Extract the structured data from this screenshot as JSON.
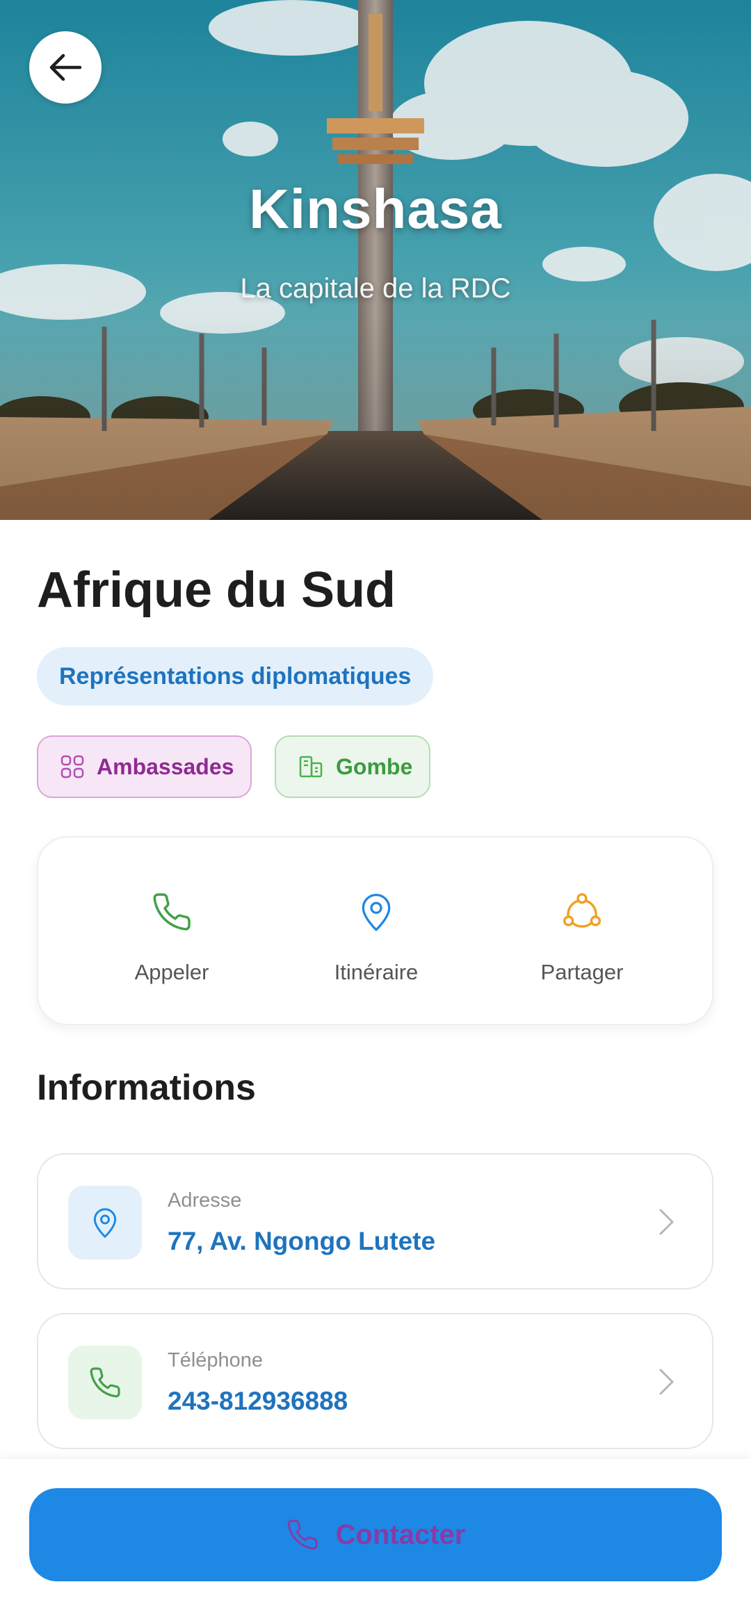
{
  "hero": {
    "title": "Kinshasa",
    "subtitle": "La capitale de la RDC"
  },
  "place": {
    "name": "Afrique du Sud",
    "category": "Représentations diplomatiques",
    "tags": [
      {
        "label": "Ambassades",
        "icon": "grid-icon"
      },
      {
        "label": "Gombe",
        "icon": "buildings-icon"
      }
    ]
  },
  "actions": [
    {
      "label": "Appeler",
      "icon": "phone-icon",
      "color": "#43a047"
    },
    {
      "label": "Itinéraire",
      "icon": "map-pin-icon",
      "color": "#1e88e5"
    },
    {
      "label": "Partager",
      "icon": "share-icon",
      "color": "#f0a020"
    }
  ],
  "informations": {
    "title": "Informations",
    "items": [
      {
        "label": "Adresse",
        "value": "77, Av. Ngongo Lutete",
        "icon": "map-pin-icon"
      },
      {
        "label": "Téléphone",
        "value": "243-812936888",
        "icon": "phone-icon"
      }
    ]
  },
  "contact_button": {
    "label": "Contacter",
    "icon": "phone-icon"
  },
  "colors": {
    "accent_blue": "#1e88e5",
    "link_blue": "#1e73be",
    "green": "#43a047",
    "purple": "#8e2a93",
    "orange": "#f0a020"
  }
}
